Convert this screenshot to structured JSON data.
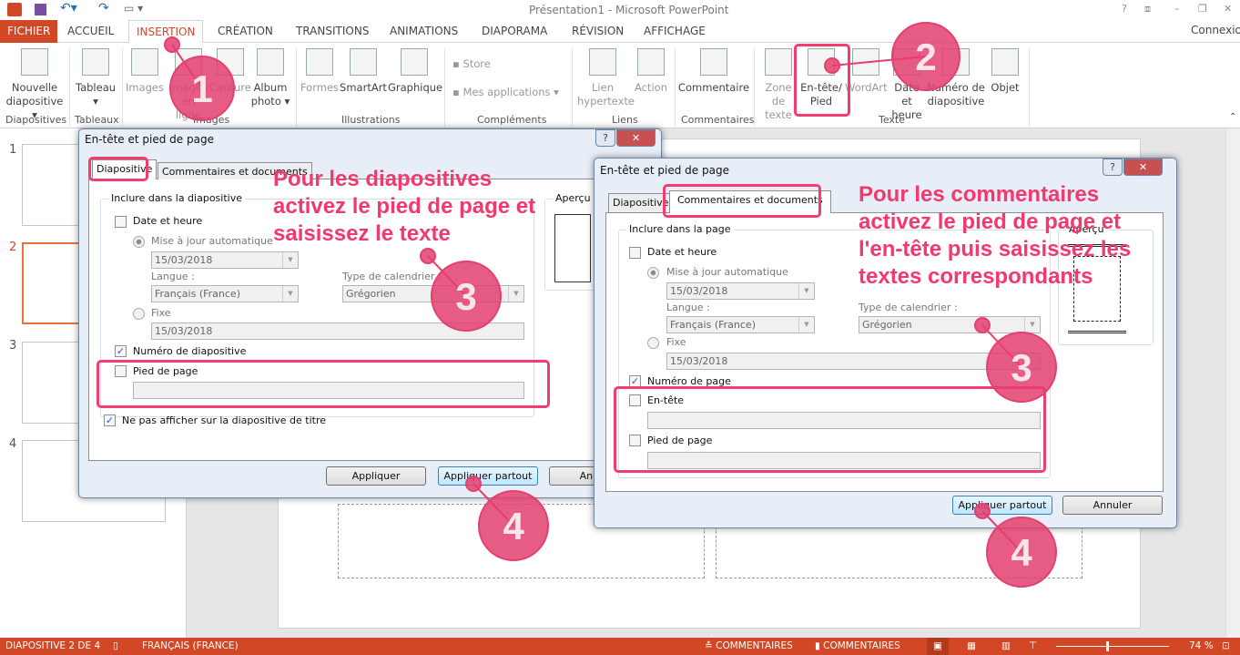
{
  "app": {
    "title": "Présentation1 - Microsoft PowerPoint",
    "connexion": "Connexion",
    "window_buttons": [
      "?",
      "⧈",
      "–",
      "❐",
      "✕"
    ]
  },
  "tabs": [
    "FICHIER",
    "ACCUEIL",
    "INSERTION",
    "CRÉATION",
    "TRANSITIONS",
    "ANIMATIONS",
    "DIAPORAMA",
    "RÉVISION",
    "AFFICHAGE"
  ],
  "ribbon": {
    "buttons": {
      "nouvelle": "Nouvelle diapositive ▾",
      "tableau": "Tableau ▾",
      "images": "Images",
      "images_ligne": "Images en ligne",
      "capture": "Capture",
      "album": "Album photo ▾",
      "formes": "Formes",
      "smartart": "SmartArt",
      "graphique": "Graphique",
      "store": "Store",
      "mes_apps": "Mes applications",
      "lien": "Lien hypertexte",
      "action": "Action",
      "commentaire": "Commentaire",
      "zone": "Zone de texte",
      "entete": "En-tête/ Pied",
      "wordart": "WordArt",
      "date": "Date et heure",
      "numero": "Numéro de diapositive",
      "objet": "Objet"
    },
    "groups": {
      "diapositives": "Diapositives",
      "tableaux": "Tableaux",
      "images": "Images",
      "illustrations": "Illustrations",
      "complements": "Compléments",
      "liens": "Liens",
      "commentaires": "Commentaires",
      "texte": "Texte"
    }
  },
  "slides": [
    "1",
    "2",
    "3",
    "4"
  ],
  "selected_slide": 2,
  "dialog1": {
    "title": "En-tête et pied de page",
    "tabs": [
      "Diapositive",
      "Commentaires et documents"
    ],
    "group": "Inclure dans la diapositive",
    "date_heure": "Date et heure",
    "auto": "Mise à jour automatique",
    "date_value": "15/03/2018",
    "langue": "Langue :",
    "langue_value": "Français (France)",
    "calendrier": "Type de calendrier :",
    "calendrier_value": "Grégorien",
    "fixe": "Fixe",
    "fixe_value": "15/03/2018",
    "numero": "Numéro de diapositive",
    "numero_checked": true,
    "pied": "Pied de page",
    "pied_value": "",
    "ne_pas": "Ne pas afficher sur la diapositive de titre",
    "ne_pas_checked": true,
    "apercu": "Aperçu",
    "buttons": [
      "Appliquer",
      "Appliquer partout",
      "Annuler"
    ]
  },
  "dialog2": {
    "title": "En-tête et pied de page",
    "tabs": [
      "Diapositive",
      "Commentaires et documents"
    ],
    "group": "Inclure dans la page",
    "date_heure": "Date et heure",
    "auto": "Mise à jour automatique",
    "date_value": "15/03/2018",
    "langue": "Langue :",
    "langue_value": "Français (France)",
    "calendrier": "Type de calendrier :",
    "calendrier_value": "Grégorien",
    "fixe": "Fixe",
    "fixe_value": "15/03/2018",
    "numero": "Numéro de page",
    "numero_checked": true,
    "entete": "En-tête",
    "entete_value": "",
    "pied": "Pied de page",
    "pied_value": "",
    "apercu": "Aperçu",
    "buttons": [
      "Appliquer partout",
      "Annuler"
    ]
  },
  "annotations": {
    "steps": [
      "1",
      "2",
      "3",
      "3",
      "4",
      "4"
    ],
    "text1": "Pour les diapositives activez le pied de page et saisissez le texte",
    "text2": "Pour les commentaires activez le pied de page et l'en-tête puis saisissez les textes correspondants",
    "color": "#f2386c"
  },
  "status": {
    "slide": "DIAPOSITIVE 2 DE 4",
    "lang": "FRANÇAIS (FRANCE)",
    "notes": "COMMENTAIRES",
    "comments": "COMMENTAIRES",
    "zoom": "74 %",
    "zoom_percent": 74
  },
  "colors": {
    "accent": "#d24726",
    "highlight": "#f23d6e"
  }
}
